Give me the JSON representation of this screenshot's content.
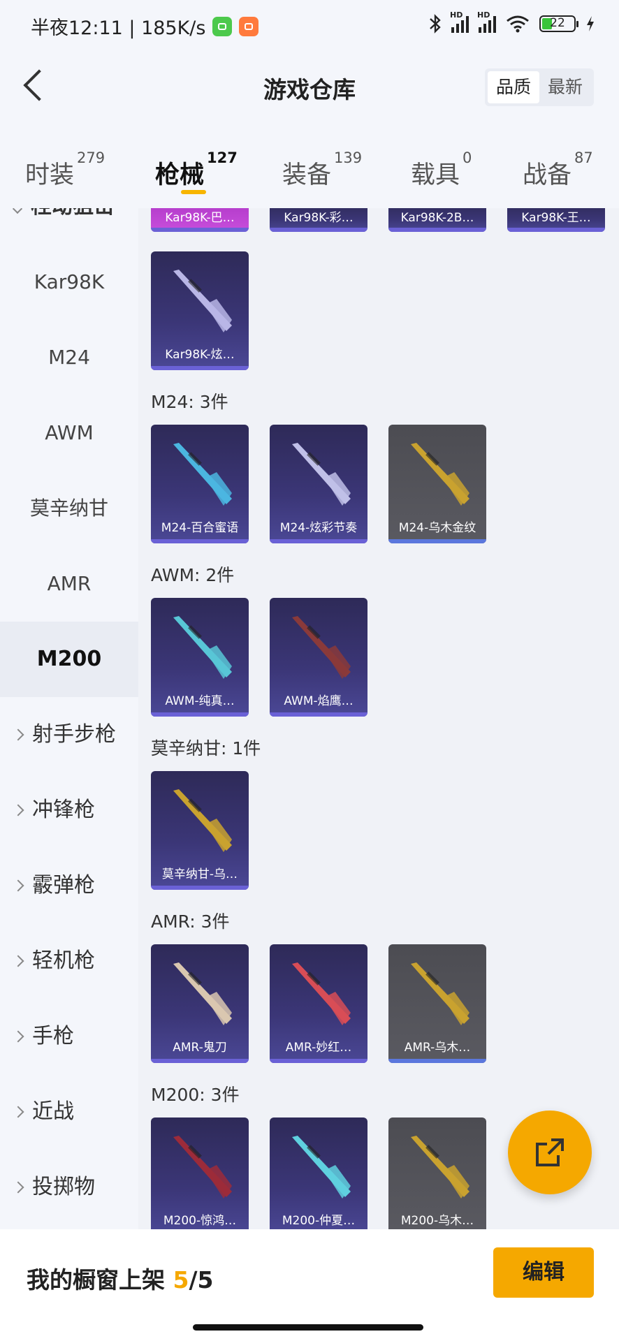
{
  "status_bar": {
    "time": "半夜12:11 | 185K/s",
    "battery": "22",
    "signal_label": "HD"
  },
  "header": {
    "title": "游戏仓库",
    "sort_options": [
      "品质",
      "最新"
    ]
  },
  "tabs": [
    {
      "label": "时装",
      "count": "279"
    },
    {
      "label": "枪械",
      "count": "127"
    },
    {
      "label": "装备",
      "count": "139"
    },
    {
      "label": "载具",
      "count": "0"
    },
    {
      "label": "战备",
      "count": "87"
    }
  ],
  "sidebar": {
    "top_group": "栓动狙击",
    "sub_items": [
      "Kar98K",
      "M24",
      "AWM",
      "莫辛纳甘",
      "AMR",
      "M200"
    ],
    "selected": "M200",
    "groups": [
      "射手步枪",
      "冲锋枪",
      "霰弹枪",
      "轻机枪",
      "手枪",
      "近战",
      "投掷物"
    ]
  },
  "top_partial_row": [
    "Kar98K-巴…",
    "Kar98K-彩…",
    "Kar98K-2B…",
    "Kar98K-王…"
  ],
  "sections": [
    {
      "title": "",
      "items": [
        {
          "label": "Kar98K-炫…",
          "color": "purple",
          "gun": "#b9b6e6"
        }
      ]
    },
    {
      "title": "M24: 3件",
      "items": [
        {
          "label": "M24-百合蜜语",
          "color": "purple",
          "gun": "#4bb6e0"
        },
        {
          "label": "M24-炫彩节奏",
          "color": "purple",
          "gun": "#c0c0e8"
        },
        {
          "label": "M24-乌木金纹",
          "color": "grey",
          "gun": "#c9a22f"
        }
      ]
    },
    {
      "title": "AWM: 2件",
      "items": [
        {
          "label": "AWM-纯真…",
          "color": "purple",
          "gun": "#58c6d6"
        },
        {
          "label": "AWM-焰鹰…",
          "color": "purple",
          "gun": "#8a3a3a"
        }
      ]
    },
    {
      "title": "莫辛纳甘: 1件",
      "items": [
        {
          "label": "莫辛纳甘-乌…",
          "color": "purple",
          "gun": "#c9a22f"
        }
      ]
    },
    {
      "title": "AMR: 3件",
      "items": [
        {
          "label": "AMR-鬼刀",
          "color": "purple",
          "gun": "#d9c7b0"
        },
        {
          "label": "AMR-妙红…",
          "color": "purple",
          "gun": "#d84d56"
        },
        {
          "label": "AMR-乌木…",
          "color": "grey",
          "gun": "#c9a22f"
        }
      ]
    },
    {
      "title": "M200: 3件",
      "items": [
        {
          "label": "M200-惊鸿…",
          "color": "purple",
          "gun": "#9c2b3a"
        },
        {
          "label": "M200-仲夏…",
          "color": "purple",
          "gun": "#5fd0df"
        },
        {
          "label": "M200-乌木…",
          "color": "grey",
          "gun": "#c9a22f"
        }
      ]
    }
  ],
  "bottom": {
    "shelf_label": "我的橱窗上架",
    "shelf_current": "5",
    "shelf_total": "/5",
    "edit_label": "编辑"
  },
  "colors": {
    "accent": "#f5a800",
    "card_purple": "#3b3677",
    "card_grey": "#55555c"
  }
}
